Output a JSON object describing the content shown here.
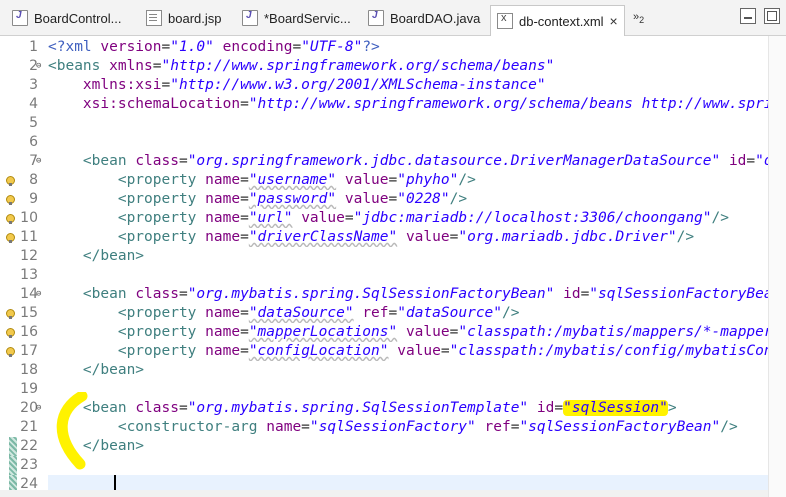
{
  "tabs": [
    {
      "label": "BoardControl...",
      "icon": "java-file-icon",
      "active": false
    },
    {
      "label": "board.jsp",
      "icon": "jsp-file-icon",
      "active": false
    },
    {
      "label": "*BoardServic...",
      "icon": "java-file-icon",
      "active": false
    },
    {
      "label": "BoardDAO.java",
      "icon": "java-file-icon",
      "active": false
    },
    {
      "label": "db-context.xml",
      "icon": "xml-file-icon",
      "active": true
    }
  ],
  "overflow_label": "»",
  "overflow_count": "2",
  "lines": [
    {
      "n": "1"
    },
    {
      "n": "2"
    },
    {
      "n": "3"
    },
    {
      "n": "4"
    },
    {
      "n": "5"
    },
    {
      "n": "6"
    },
    {
      "n": "7"
    },
    {
      "n": "8"
    },
    {
      "n": "9"
    },
    {
      "n": "10"
    },
    {
      "n": "11"
    },
    {
      "n": "12"
    },
    {
      "n": "13"
    },
    {
      "n": "14"
    },
    {
      "n": "15"
    },
    {
      "n": "16"
    },
    {
      "n": "17"
    },
    {
      "n": "18"
    },
    {
      "n": "19"
    },
    {
      "n": "20"
    },
    {
      "n": "21"
    },
    {
      "n": "22"
    },
    {
      "n": "23"
    },
    {
      "n": "24"
    }
  ],
  "code": {
    "l1": {
      "open": "<?xml ",
      "a1": "version",
      "a2": "encoding",
      "v1": "\"1.0\"",
      "v2": "\"UTF-8\"",
      "close": "?>"
    },
    "l2": {
      "tag": "<beans ",
      "attr": "xmlns",
      "val": "\"http://www.springframework.org/schema/beans\""
    },
    "l3": {
      "attr": "xmlns:xsi",
      "val": "\"http://www.w3.org/2001/XMLSchema-instance\""
    },
    "l4": {
      "attr": "xsi:schemaLocation",
      "val": "\"http://www.springframework.org/schema/beans http://www.springframework.org/schema/beans/spring-beans.xsd\""
    },
    "l7": {
      "tag": "<bean ",
      "a1": "class",
      "v1": "\"org.springframework.jdbc.datasource.DriverManagerDataSource\"",
      "a2": "id",
      "v2": "\"dataSource\">"
    },
    "l8": {
      "tag": "<property ",
      "a1": "name",
      "v1": "\"username\"",
      "a2": "value",
      "v2": "\"phyho\"",
      "close": "/>"
    },
    "l9": {
      "tag": "<property ",
      "a1": "name",
      "v1": "\"password\"",
      "a2": "value",
      "v2": "\"0228\"",
      "close": "/>"
    },
    "l10": {
      "tag": "<property ",
      "a1": "name",
      "v1": "\"url\"",
      "a2": "value",
      "v2": "\"jdbc:mariadb://localhost:3306/choongang\"",
      "close": "/>"
    },
    "l11": {
      "tag": "<property ",
      "a1": "name",
      "v1": "\"driverClassName\"",
      "a2": "value",
      "v2": "\"org.mariadb.jdbc.Driver\"",
      "close": "/>"
    },
    "l12": {
      "tag": "</bean>"
    },
    "l14": {
      "tag": "<bean ",
      "a1": "class",
      "v1": "\"org.mybatis.spring.SqlSessionFactoryBean\"",
      "a2": "id",
      "v2": "\"sqlSessionFactoryBean\"",
      "close": ">"
    },
    "l15": {
      "tag": "<property ",
      "a1": "name",
      "v1": "\"dataSource\"",
      "a2": "ref",
      "v2": "\"dataSource\"",
      "close": "/>"
    },
    "l16": {
      "tag": "<property ",
      "a1": "name",
      "v1": "\"mapperLocations\"",
      "a2": "value",
      "v2": "\"classpath:/mybatis/mappers/*-mapper.xml\"",
      "close": "/>"
    },
    "l17": {
      "tag": "<property ",
      "a1": "name",
      "v1": "\"configLocation\"",
      "a2": "value",
      "v2": "\"classpath:/mybatis/config/mybatisConfig.xml\"",
      "close": "/>"
    },
    "l18": {
      "tag": "</bean>"
    },
    "l20": {
      "tag": "<bean ",
      "a1": "class",
      "v1": "\"org.mybatis.spring.SqlSessionTemplate\"",
      "a2": "id",
      "v2": "\"sqlSession\"",
      "close": ">"
    },
    "l21": {
      "tag": "<constructor-arg ",
      "a1": "name",
      "v1": "\"sqlSessionFactory\"",
      "a2": "ref",
      "v2": "\"sqlSessionFactoryBean\"",
      "close": "/>"
    },
    "l22": {
      "tag": "</bean>"
    }
  },
  "colors": {
    "tag": "#3f7f7f",
    "attribute": "#7f007f",
    "string": "#2a00ff",
    "highlight": "#fff200",
    "current_line": "#e8f2fe"
  }
}
